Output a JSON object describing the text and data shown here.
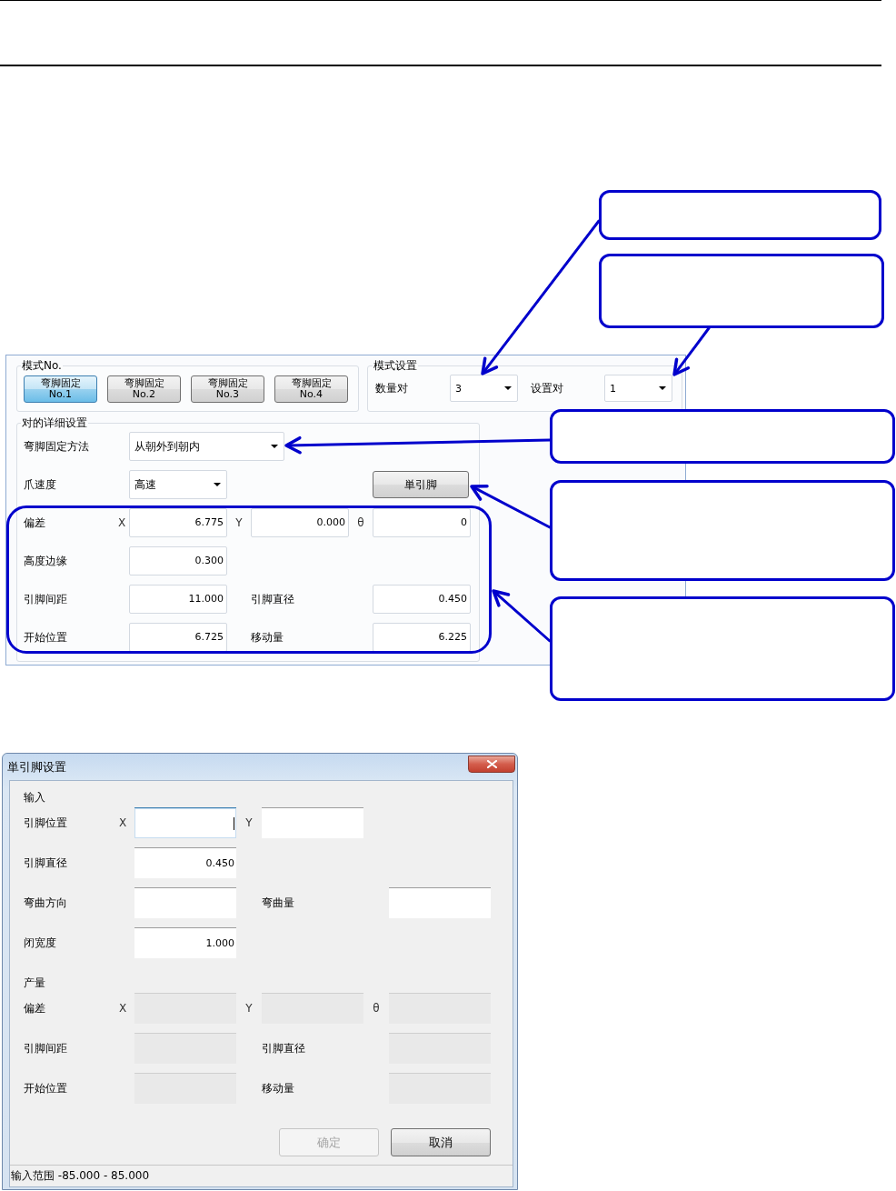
{
  "mode_panel": {
    "pattern_group": {
      "title": "模式No.",
      "buttons": [
        {
          "line_1": "弯脚固定",
          "line_2": "No.1",
          "selected": true
        },
        {
          "line_1": "弯脚固定",
          "line_2": "No.2",
          "selected": false
        },
        {
          "line_1": "弯脚固定",
          "line_2": "No.3",
          "selected": false
        },
        {
          "line_1": "弯脚固定",
          "line_2": "No.4",
          "selected": false
        }
      ]
    },
    "pattern_settings": {
      "title": "模式设置",
      "dropdowns": [
        {
          "label": "数量对",
          "value": "3"
        },
        {
          "label": "设置对",
          "value": "1"
        }
      ]
    },
    "pair_details": {
      "title": "对的详细设置",
      "method": {
        "label": "弯脚固定方法",
        "value": "从朝外到朝内"
      },
      "claw_speed": {
        "label": "爪速度",
        "value": "高速"
      },
      "single_pin_button": "単引脚",
      "rows": [
        {
          "kind": "axes",
          "label": "偏差",
          "fields": [
            {
              "axis": "X",
              "value": "6.775"
            },
            {
              "axis": "Y",
              "value": "0.000"
            },
            {
              "axis": "θ",
              "value": "0"
            }
          ]
        },
        {
          "kind": "single",
          "label": "高度边缘",
          "value": "0.300"
        },
        {
          "kind": "pair",
          "label": "引脚间距",
          "value": "11.000",
          "label_2": "引脚直径",
          "value_2": "0.450"
        },
        {
          "kind": "pair",
          "label": "开始位置",
          "value": "6.725",
          "label_2": "移动量",
          "value_2": "6.225"
        }
      ]
    }
  },
  "dialog": {
    "title": "単引脚设置",
    "sections": [
      {
        "title": "输入",
        "readonly": false,
        "rows": [
          {
            "kind": "axes",
            "label": "引脚位置",
            "fields": [
              {
                "axis": "X",
                "focused": true
              },
              {
                "axis": "Y",
                "focused": false
              }
            ]
          },
          {
            "kind": "single",
            "label": "引脚直径",
            "value": "0.450"
          },
          {
            "kind": "pair",
            "label": "弯曲方向",
            "label_2": "弯曲量"
          },
          {
            "kind": "single",
            "label": "闭宽度",
            "value": "1.000"
          }
        ]
      },
      {
        "title": "产量",
        "readonly": true,
        "rows": [
          {
            "kind": "axes",
            "label": "偏差",
            "fields": [
              {
                "axis": "X"
              },
              {
                "axis": "Y"
              },
              {
                "axis": "θ"
              }
            ]
          },
          {
            "kind": "pair",
            "label": "引脚间距",
            "label_2": "引脚直径"
          },
          {
            "kind": "pair",
            "label": "开始位置",
            "label_2": "移动量"
          }
        ]
      }
    ],
    "buttons": [
      {
        "label": "确定",
        "disabled": true
      },
      {
        "label": "取消",
        "disabled": false
      }
    ],
    "status_bar": "输入范围 -85.000 - 85.000"
  }
}
